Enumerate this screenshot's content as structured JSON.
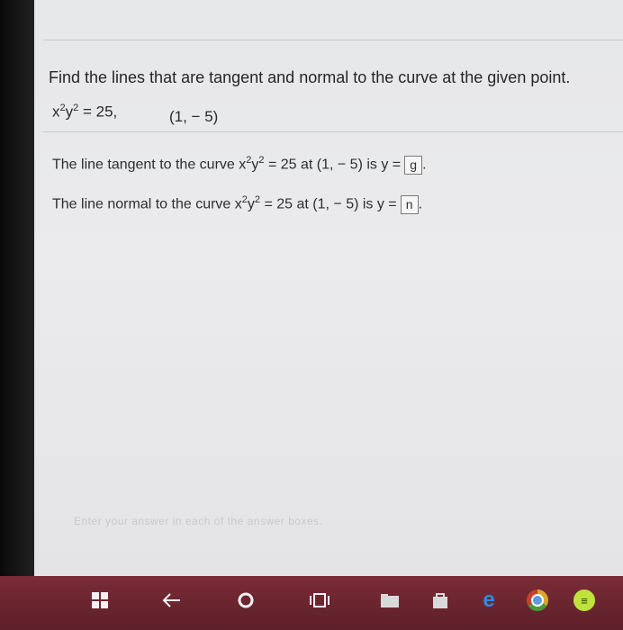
{
  "question": {
    "title": "Find the lines that are tangent and normal to the curve at the given point.",
    "eq_x": "x",
    "eq_x_exp": "2",
    "eq_y": "y",
    "eq_y_exp": "2",
    "eq_rhs": " = 25,",
    "point": "(1, − 5)"
  },
  "tangent": {
    "prefix": "The line tangent to the curve x",
    "x_exp": "2",
    "y": "y",
    "y_exp": "2",
    "suffix": " = 25 at (1, − 5) is y =",
    "answer": "g",
    "end": "."
  },
  "normal": {
    "prefix": "The line normal to the curve x",
    "x_exp": "2",
    "y": "y",
    "y_exp": "2",
    "suffix": " = 25 at (1, − 5) is y =",
    "answer": "n",
    "end": "."
  },
  "footer": {
    "faint_text": "Enter your answer in each of the answer boxes."
  },
  "taskbar": {
    "start_icon": "windows-icon",
    "back_icon": "back-arrow-icon",
    "home_icon": "circle-icon",
    "multitask_icon": "task-view-icon",
    "apps": [
      "folder-icon",
      "store-icon",
      "edge-icon",
      "chrome-icon",
      "spotify-icon"
    ],
    "colors": {
      "taskbar": "#6b2530",
      "edge": "#2f8be0",
      "spotify": "#bfe33a"
    }
  }
}
